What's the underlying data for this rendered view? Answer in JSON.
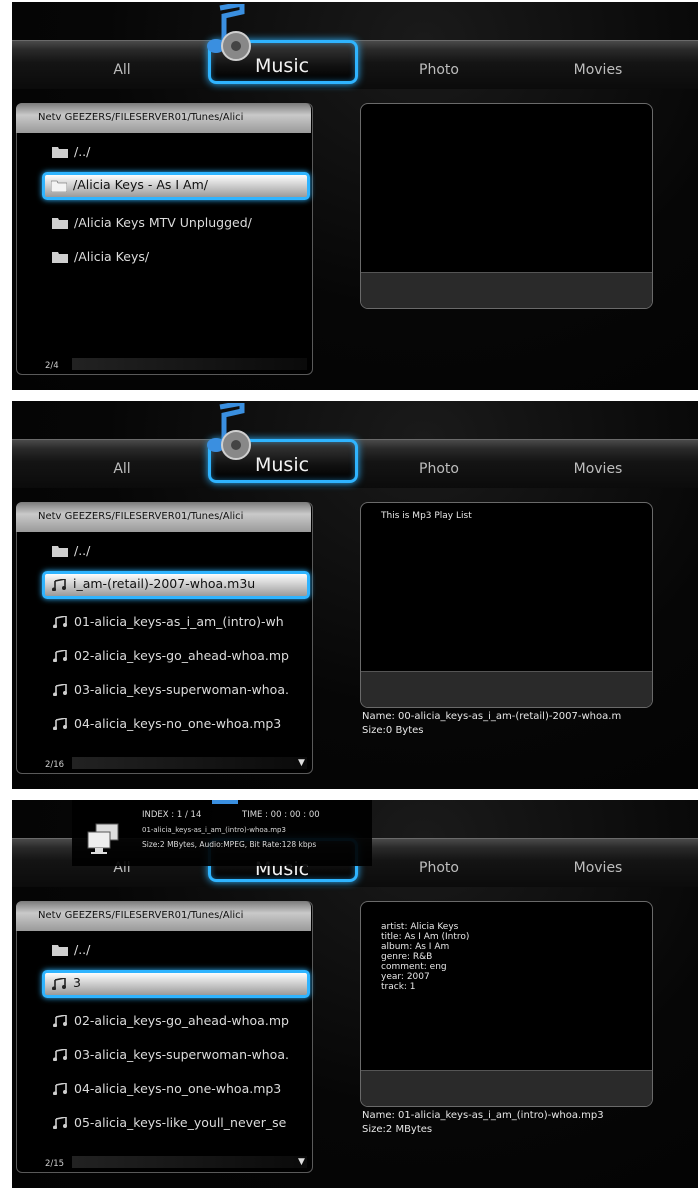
{
  "tabs": {
    "all": "All",
    "music": "Music",
    "photo": "Photo",
    "movies": "Movies"
  },
  "panels": [
    {
      "path": "Netv GEEZERS/FILESERVER01/Tunes/Alici",
      "items": [
        {
          "label": "/../",
          "icon": "folder-icon",
          "selected": false
        },
        {
          "label": "/Alicia Keys - As I Am/",
          "icon": "folder-icon",
          "selected": true
        },
        {
          "label": "/Alicia Keys MTV Unplugged/",
          "icon": "folder-icon",
          "selected": false
        },
        {
          "label": "/Alicia Keys/",
          "icon": "folder-icon",
          "selected": false
        }
      ],
      "pager": "2/4",
      "preview": "",
      "info_name": "",
      "info_size": ""
    },
    {
      "path": "Netv GEEZERS/FILESERVER01/Tunes/Alici",
      "items": [
        {
          "label": "/../",
          "icon": "folder-icon",
          "selected": false
        },
        {
          "label": "i_am-(retail)-2007-whoa.m3u",
          "icon": "music-note-icon",
          "selected": true
        },
        {
          "label": "01-alicia_keys-as_i_am_(intro)-wh",
          "icon": "music-note-icon",
          "selected": false
        },
        {
          "label": "02-alicia_keys-go_ahead-whoa.mp",
          "icon": "music-note-icon",
          "selected": false
        },
        {
          "label": "03-alicia_keys-superwoman-whoa.",
          "icon": "music-note-icon",
          "selected": false
        },
        {
          "label": "04-alicia_keys-no_one-whoa.mp3",
          "icon": "music-note-icon",
          "selected": false
        }
      ],
      "pager": "2/16",
      "preview": "This is Mp3 Play List",
      "info_name": "Name: 00-alicia_keys-as_i_am-(retail)-2007-whoa.m",
      "info_size": "Size:0 Bytes"
    },
    {
      "path": "Netv GEEZERS/FILESERVER01/Tunes/Alici",
      "items": [
        {
          "label": "/../",
          "icon": "folder-icon",
          "selected": false
        },
        {
          "label": "3",
          "icon": "music-note-icon",
          "selected": true
        },
        {
          "label": "02-alicia_keys-go_ahead-whoa.mp",
          "icon": "music-note-icon",
          "selected": false
        },
        {
          "label": "03-alicia_keys-superwoman-whoa.",
          "icon": "music-note-icon",
          "selected": false
        },
        {
          "label": "04-alicia_keys-no_one-whoa.mp3",
          "icon": "music-note-icon",
          "selected": false
        },
        {
          "label": "05-alicia_keys-like_youll_never_se",
          "icon": "music-note-icon",
          "selected": false
        }
      ],
      "pager": "2/15",
      "preview": "artist: Alicia Keys\ntitle: As I Am (Intro)\nalbum: As I Am\ngenre: R&B\ncomment: eng\nyear: 2007\ntrack: 1",
      "info_name": "Name: 01-alicia_keys-as_i_am_(intro)-whoa.mp3",
      "info_size": "Size:2 MBytes",
      "osd": {
        "index": "INDEX : 1 / 14",
        "time": "TIME : 00 : 00 : 00",
        "file": "01-alicia_keys-as_i_am_(intro)-whoa.mp3",
        "meta": "Size:2 MBytes, Audio:MPEG, Bit Rate:128 kbps"
      }
    }
  ],
  "colors": {
    "accent": "#2fb4ff",
    "background": "#050505",
    "text": "#dcdcdc"
  }
}
